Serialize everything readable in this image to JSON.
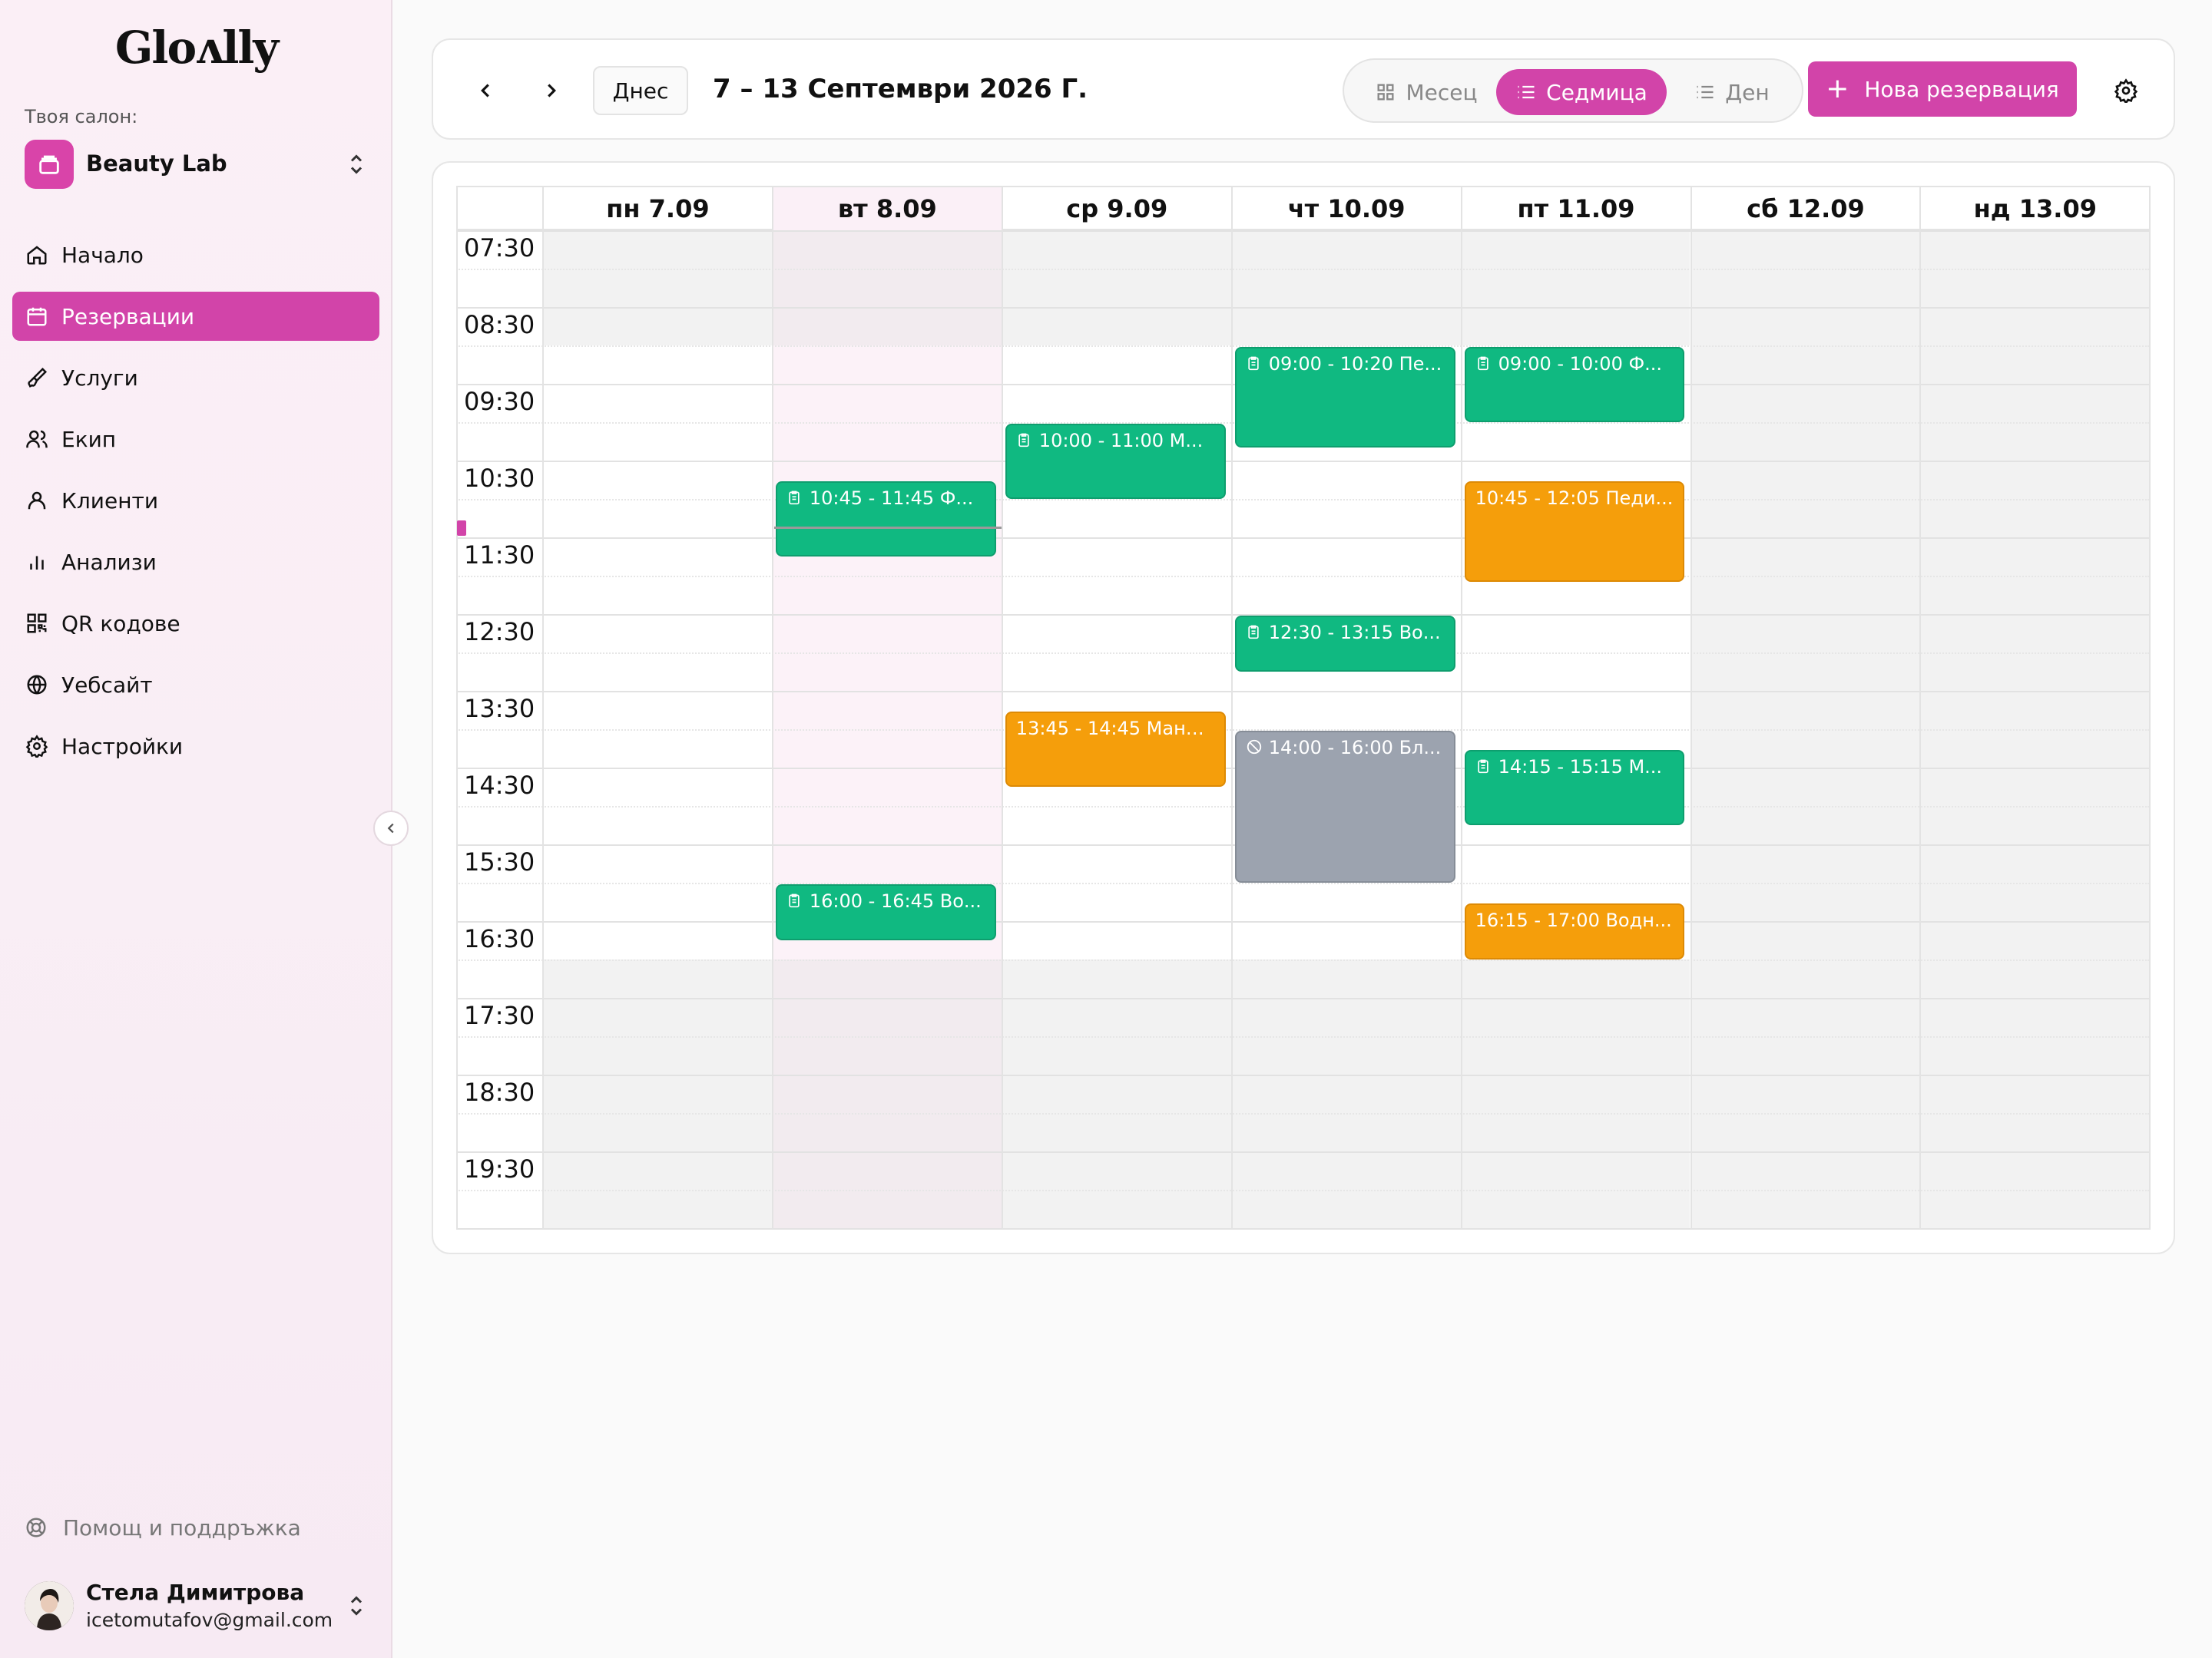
{
  "sidebar": {
    "logo": "Gloʌlly",
    "salon_caption": "Твоя салон:",
    "salon_name": "Beauty Lab",
    "items": [
      {
        "label": "Начало",
        "icon": "home-icon"
      },
      {
        "label": "Резервации",
        "icon": "calendar-icon",
        "active": true
      },
      {
        "label": "Услуги",
        "icon": "brush-icon"
      },
      {
        "label": "Екип",
        "icon": "team-icon"
      },
      {
        "label": "Клиенти",
        "icon": "user-icon"
      },
      {
        "label": "Анализи",
        "icon": "bar-chart-icon"
      },
      {
        "label": "QR кодове",
        "icon": "qr-code-icon"
      },
      {
        "label": "Уебсайт",
        "icon": "globe-icon"
      },
      {
        "label": "Настройки",
        "icon": "gear-icon"
      }
    ],
    "help_label": "Помощ и поддръжка",
    "user": {
      "name": "Стела Димитрова",
      "email": "icetomutafov@gmail.com"
    }
  },
  "toolbar": {
    "today_label": "Днес",
    "range_title": "7 – 13 Септември 2026 Г.",
    "views": [
      {
        "label": "Месец",
        "icon": "grid-icon"
      },
      {
        "label": "Седмица",
        "icon": "list-icon",
        "active": true
      },
      {
        "label": "Ден",
        "icon": "list-icon"
      }
    ],
    "new_booking_label": "Нова резервация"
  },
  "calendar": {
    "days": [
      "пн 7.09",
      "вт 8.09",
      "ср 9.09",
      "чт 10.09",
      "пт 11.09",
      "сб 12.09",
      "нд 13.09"
    ],
    "today_index": 1,
    "time_labels": [
      "07:30",
      "08:30",
      "09:30",
      "10:30",
      "11:30",
      "12:30",
      "13:30",
      "14:30",
      "15:30",
      "16:30",
      "17:30",
      "18:30",
      "19:30"
    ],
    "current_time": "11:05",
    "events": [
      {
        "day": 1,
        "start": "10:45",
        "end": "11:45",
        "label": "10:45 - 11:45 Ф...",
        "color": "green",
        "icon": "clipboard-icon"
      },
      {
        "day": 1,
        "start": "16:00",
        "end": "16:45",
        "label": "16:00 - 16:45 Во...",
        "color": "green",
        "icon": "clipboard-icon"
      },
      {
        "day": 2,
        "start": "10:00",
        "end": "11:00",
        "label": "10:00 - 11:00 М...",
        "color": "green",
        "icon": "clipboard-icon"
      },
      {
        "day": 2,
        "start": "13:45",
        "end": "14:45",
        "label": "13:45 - 14:45 Мани...",
        "color": "orange",
        "icon": ""
      },
      {
        "day": 3,
        "start": "09:00",
        "end": "10:20",
        "label": "09:00 - 10:20 Пе...",
        "color": "green",
        "icon": "clipboard-icon"
      },
      {
        "day": 3,
        "start": "12:30",
        "end": "13:15",
        "label": "12:30 - 13:15 Во...",
        "color": "green",
        "icon": "clipboard-icon"
      },
      {
        "day": 3,
        "start": "14:00",
        "end": "16:00",
        "label": "14:00 - 16:00 Бл...",
        "color": "gray",
        "icon": "blocked-icon"
      },
      {
        "day": 4,
        "start": "09:00",
        "end": "10:00",
        "label": "09:00 - 10:00 Ф...",
        "color": "green",
        "icon": "clipboard-icon"
      },
      {
        "day": 4,
        "start": "10:45",
        "end": "12:05",
        "label": "10:45 - 12:05 Педи...",
        "color": "orange",
        "icon": ""
      },
      {
        "day": 4,
        "start": "14:15",
        "end": "15:15",
        "label": "14:15 - 15:15 М...",
        "color": "green",
        "icon": "clipboard-icon"
      },
      {
        "day": 4,
        "start": "16:15",
        "end": "17:00",
        "label": "16:15 - 17:00 Водн...",
        "color": "orange",
        "icon": ""
      }
    ]
  },
  "colors": {
    "accent": "#d244a9",
    "green": "#10b981",
    "orange": "#f59e0b",
    "gray": "#9ca3af"
  }
}
